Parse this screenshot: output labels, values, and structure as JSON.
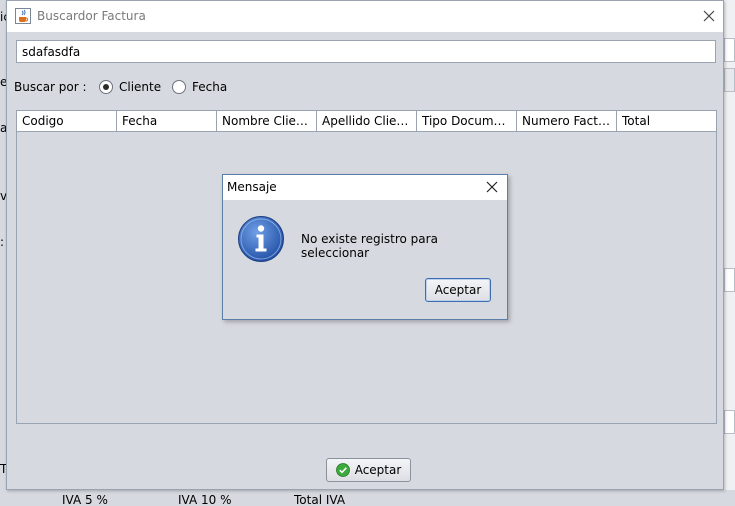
{
  "background": {
    "fragments": [
      "ic",
      "er",
      "a",
      "v",
      ":",
      "To"
    ],
    "footer_labels": [
      "IVA 5 %",
      "IVA 10 %",
      "Total IVA"
    ]
  },
  "main_dialog": {
    "title": "Buscardor Factura",
    "search_value": "sdafasdfa",
    "buscar_label": "Buscar por :",
    "radio_options": [
      {
        "label": "Cliente",
        "selected": true
      },
      {
        "label": "Fecha",
        "selected": false
      }
    ],
    "table": {
      "columns": [
        "Codigo",
        "Fecha",
        "Nombre Cliente",
        "Apellido Cliente",
        "Tipo Documen...",
        "Numero Factura",
        "Total"
      ],
      "rows": []
    },
    "ok_label": "Aceptar"
  },
  "message_dialog": {
    "title": "Mensaje",
    "message": "No existe registro para seleccionar",
    "ok_label": "Aceptar"
  },
  "icons": {
    "app": "java-cup-icon",
    "close": "close-icon",
    "info": "information-icon",
    "ok": "green-check-icon"
  },
  "colors": {
    "dialog_bg": "#d6d9df",
    "title_bg": "#ffffff",
    "info_blue": "#2f63b8",
    "ok_green": "#3caa3c"
  }
}
